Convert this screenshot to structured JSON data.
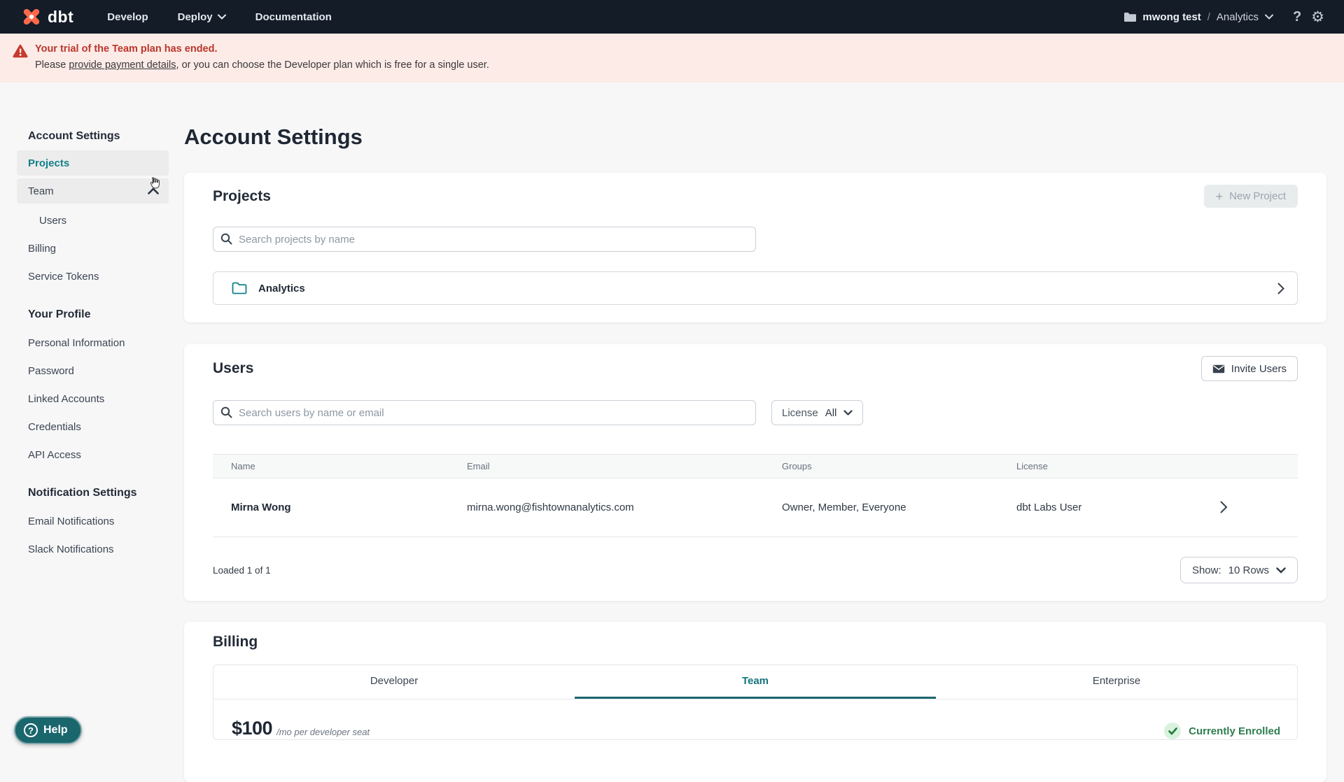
{
  "navbar": {
    "logo_text": "dbt",
    "items": [
      {
        "label": "Develop"
      },
      {
        "label": "Deploy"
      },
      {
        "label": "Documentation"
      }
    ],
    "account_name": "mwong test",
    "separator": "/",
    "project_name": "Analytics"
  },
  "banner": {
    "title": "Your trial of the Team plan has ended.",
    "body_prefix": "Please ",
    "link_text": "provide payment details",
    "body_suffix": ", or you can choose the Developer plan which is free for a single user."
  },
  "sidebar": {
    "sections": [
      {
        "heading": "Account Settings",
        "items": [
          {
            "label": "Projects"
          },
          {
            "label": "Team"
          },
          {
            "label": "Users"
          },
          {
            "label": "Billing"
          },
          {
            "label": "Service Tokens"
          }
        ]
      },
      {
        "heading": "Your Profile",
        "items": [
          {
            "label": "Personal Information"
          },
          {
            "label": "Password"
          },
          {
            "label": "Linked Accounts"
          },
          {
            "label": "Credentials"
          },
          {
            "label": "API Access"
          }
        ]
      },
      {
        "heading": "Notification Settings",
        "items": [
          {
            "label": "Email Notifications"
          },
          {
            "label": "Slack Notifications"
          }
        ]
      }
    ]
  },
  "main": {
    "page_title": "Account Settings",
    "projects": {
      "heading": "Projects",
      "new_project_label": "New Project",
      "search_placeholder": "Search projects by name",
      "rows": [
        {
          "name": "Analytics"
        }
      ]
    },
    "users": {
      "heading": "Users",
      "invite_label": "Invite Users",
      "search_placeholder": "Search users by name or email",
      "license_filter_label": "License",
      "license_filter_value": "All",
      "table": {
        "columns": [
          "Name",
          "Email",
          "Groups",
          "License"
        ],
        "rows": [
          {
            "name": "Mirna Wong",
            "email": "mirna.wong@fishtownanalytics.com",
            "groups": "Owner, Member, Everyone",
            "license": "dbt Labs User"
          }
        ]
      },
      "loaded_text": "Loaded 1 of 1",
      "show_label": "Show:",
      "show_value": "10 Rows"
    },
    "billing": {
      "heading": "Billing",
      "tabs": [
        {
          "label": "Developer"
        },
        {
          "label": "Team"
        },
        {
          "label": "Enterprise"
        }
      ],
      "price": "$100",
      "price_suffix": "/mo per developer seat",
      "enrolled_text": "Currently Enrolled"
    }
  },
  "help": {
    "label": "Help"
  },
  "colors": {
    "navbar_bg": "#141c28",
    "brand_orange": "#ff694a",
    "accent_teal": "#12808a",
    "accent_teal_dark": "#1d666d",
    "banner_bg": "#fcebe7",
    "alert_red": "#bb362c",
    "enrolled_green": "#2e7d4f",
    "disabled_gray": "#e9eced"
  }
}
